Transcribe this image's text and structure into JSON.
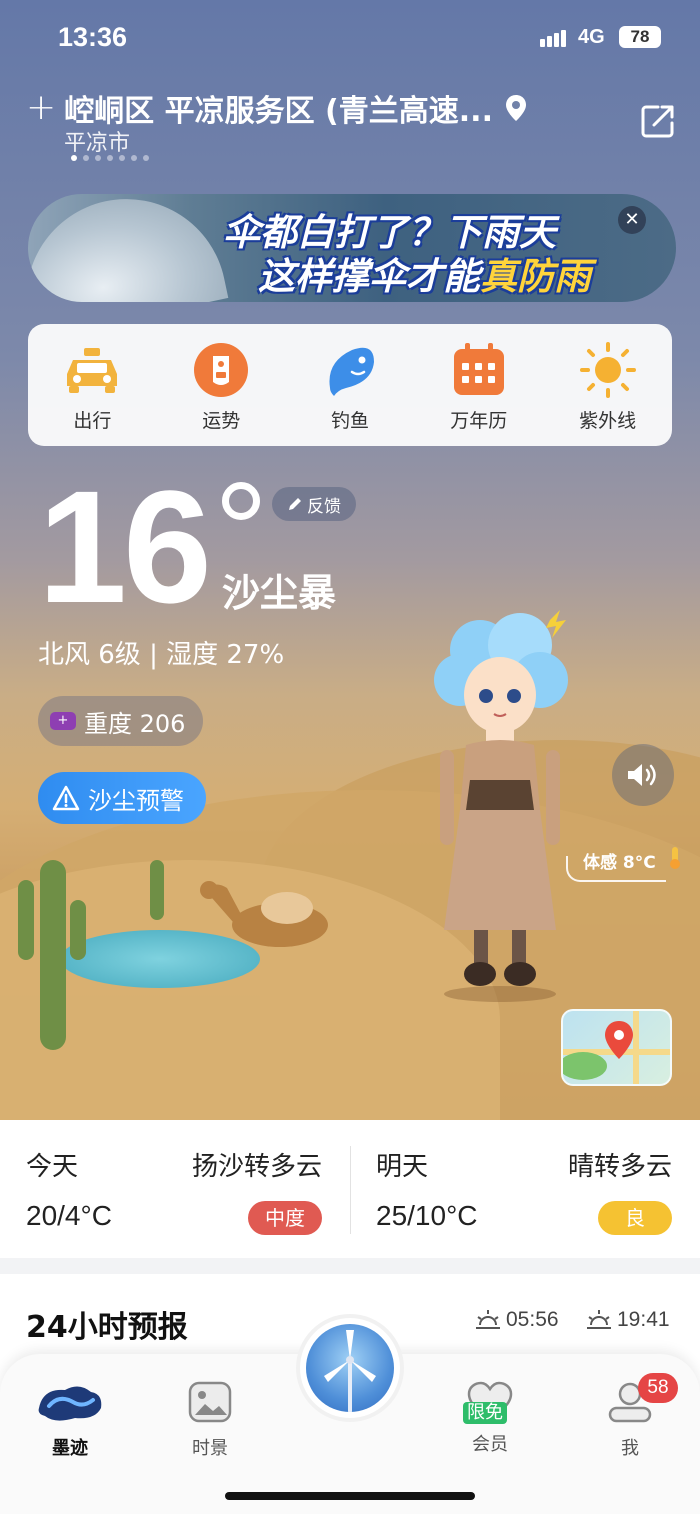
{
  "status": {
    "time": "13:36",
    "network": "4G",
    "battery": "78"
  },
  "location": {
    "title": "崆峒区 平凉服务区 (青兰高速...",
    "city": "平凉市"
  },
  "banner": {
    "line1": "伞都白打了？下雨天",
    "line2_prefix": "这样撑伞才能",
    "line2_highlight": "真防雨"
  },
  "quick_actions": [
    {
      "label": "出行",
      "icon": "taxi-icon",
      "color": "#f2b33d"
    },
    {
      "label": "运势",
      "icon": "fortune-icon",
      "color": "#f07a3a"
    },
    {
      "label": "钓鱼",
      "icon": "fish-icon",
      "color": "#3d8ee8"
    },
    {
      "label": "万年历",
      "icon": "calendar-icon",
      "color": "#f07a3a"
    },
    {
      "label": "紫外线",
      "icon": "sun-icon",
      "color": "#f5b132"
    }
  ],
  "current": {
    "temperature": "16",
    "condition": "沙尘暴",
    "wind_humidity": "北风 6级 | 湿度 27%",
    "feedback": "反馈",
    "aqi": "重度 206",
    "warning": "沙尘预警",
    "feels_like": "体感 8°C"
  },
  "forecast": {
    "today": {
      "day": "今天",
      "weather": "扬沙转多云",
      "range": "20/4°C",
      "aqi": "中度",
      "aqi_color": "#e05a52"
    },
    "tomorrow": {
      "day": "明天",
      "weather": "晴转多云",
      "range": "25/10°C",
      "aqi": "良",
      "aqi_color": "#f5c232"
    }
  },
  "hourly": {
    "title": "24小时预报",
    "sunrise": "05:56",
    "sunset": "19:41"
  },
  "tabs": [
    {
      "label": "墨迹",
      "icon": "moji-logo-icon"
    },
    {
      "label": "时景",
      "icon": "photo-icon"
    },
    {
      "label": "会员",
      "icon": "member-icon",
      "tag": "限免"
    },
    {
      "label": "我",
      "icon": "profile-icon",
      "badge": "58"
    }
  ],
  "colors": {
    "accent_blue": "#3d8ee8",
    "warning_blue": "#2f8cf0",
    "badge_red": "#e54545"
  }
}
